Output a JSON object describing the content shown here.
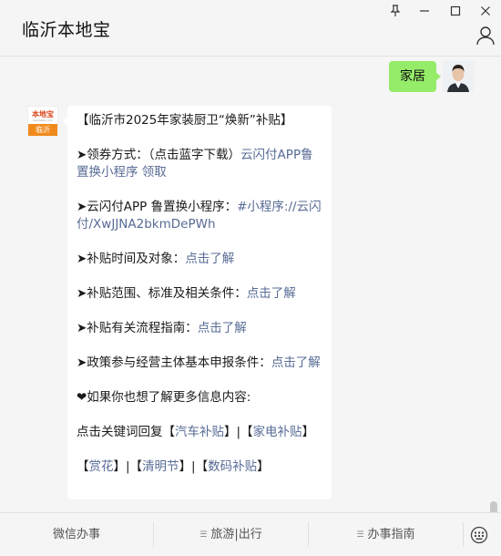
{
  "window": {
    "title": "临沂本地宝",
    "controls": [
      "pin-icon",
      "minimize-icon",
      "maximize-icon",
      "close-icon"
    ],
    "profile_icon": "person-icon"
  },
  "chat": {
    "user_message": {
      "text": "家居",
      "bubble_color": "#95ec69"
    },
    "bot_avatar": {
      "brand": "本地宝",
      "subtitle": "bendibao.com",
      "city": "临沂",
      "accent": "#f08a1c"
    },
    "article": {
      "title": "【临沂市2025年家装厨卫“焕新”补贴】",
      "items": [
        {
          "label": "➤领券方式：（点击蓝字下载）",
          "link": "云闪付APP鲁置换小程序 领取"
        },
        {
          "label": "➤云闪付APP 鲁置换小程序：",
          "link": "#小程序://云闪付/XwJJNA2bkmDePWh"
        },
        {
          "label": "➤补贴时间及对象：",
          "link": "点击了解"
        },
        {
          "label": "➤补贴范围、标准及相关条件：",
          "link": "点击了解"
        },
        {
          "label": "➤补贴有关流程指南：",
          "link": "点击了解"
        },
        {
          "label": "➤政策参与经营主体基本申报条件：",
          "link": "点击了解"
        }
      ],
      "more_info": "❤如果你也想了解更多信息内容:",
      "keyword_intro": "点击关键词回复",
      "keywords_row1": [
        "汽车补贴",
        "家电补贴"
      ],
      "keywords_row2": [
        "赏花",
        "清明节",
        "数码补贴"
      ],
      "link_color": "#576b95"
    }
  },
  "bottom_menu": {
    "tabs": [
      "微信办事",
      "旅游|出行",
      "办事指南"
    ],
    "keyboard_icon": "keyboard-icon"
  }
}
